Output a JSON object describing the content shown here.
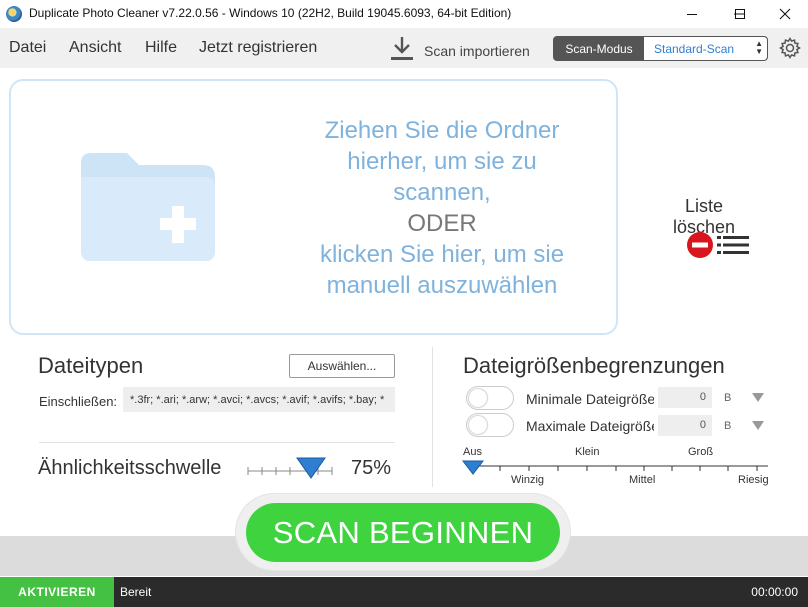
{
  "window": {
    "title": "Duplicate Photo Cleaner v7.22.0.56 - Windows 10 (22H2, Build 19045.6093, 64-bit Edition)"
  },
  "menu": {
    "items": [
      "Datei",
      "Ansicht",
      "Hilfe",
      "Jetzt registrieren"
    ]
  },
  "toolbar": {
    "import_label": "Scan importieren",
    "scan_mode_label": "Scan-Modus",
    "scan_mode_value": "Standard-Scan"
  },
  "dropzone": {
    "line1": "Ziehen Sie die Ordner",
    "line2": "hierher, um sie zu",
    "line3": "scannen,",
    "or": "ODER",
    "line4": "klicken Sie hier, um sie",
    "line5": "manuell auszuwählen"
  },
  "clear_list": {
    "label": "Liste löschen"
  },
  "filetypes": {
    "title": "Dateitypen",
    "select_button": "Auswählen...",
    "include_label": "Einschließen:",
    "include_value": "*.3fr; *.ari; *.arw; *.avci; *.avcs; *.avif; *.avifs; *.bay; *"
  },
  "similarity": {
    "label": "Ähnlichkeitsschwelle",
    "value": "75%",
    "level": 0.75
  },
  "size_limits": {
    "title": "Dateigrößenbegrenzungen",
    "min_label": "Minimale Dateigröße",
    "min_value": "0",
    "min_unit": "B",
    "max_label": "Maximale Dateigröße",
    "max_value": "0",
    "max_unit": "B",
    "scale_top": [
      "Aus",
      "Klein",
      "Groß"
    ],
    "scale_bottom": [
      "Winzig",
      "Mittel",
      "Riesig"
    ]
  },
  "scan_button": {
    "label": "SCAN BEGINNEN"
  },
  "statusbar": {
    "activate_label": "AKTIVIEREN",
    "status": "Bereit",
    "timer": "00:00:00"
  },
  "colors": {
    "accent_blue": "#2f7fd0",
    "drop_text": "#7fb2dc",
    "scan_green": "#3fd43f",
    "activate_green": "#44c043"
  }
}
